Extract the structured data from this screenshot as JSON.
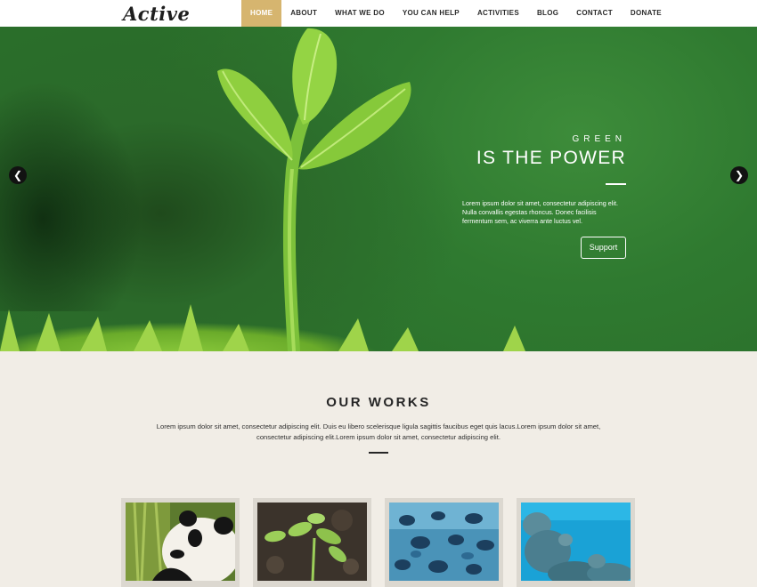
{
  "brand": {
    "logo": "Active"
  },
  "nav": {
    "items": [
      {
        "label": "HOME",
        "active": true
      },
      {
        "label": "ABOUT"
      },
      {
        "label": "WHAT WE DO"
      },
      {
        "label": "YOU CAN HELP"
      },
      {
        "label": "ACTIVITIES"
      },
      {
        "label": "BLOG"
      },
      {
        "label": "CONTACT"
      },
      {
        "label": "DONATE"
      }
    ],
    "accent": "#d6b56f"
  },
  "hero": {
    "kicker": "GREEN",
    "title": "IS THE POWER",
    "text": "Lorem ipsum dolor sit amet, consectetur adipiscing elit. Nulla convallis egestas rhoncus. Donec facilisis fermentum sem, ac viverra ante luctus vel.",
    "button": "Support",
    "prev_icon": "chevron-left-icon",
    "next_icon": "chevron-right-icon"
  },
  "works": {
    "title": "OUR WORKS",
    "text": "Lorem ipsum dolor sit amet, consectetur adipiscing elit. Duis eu libero scelerisque ligula sagittis faucibus eget quis lacus.Lorem ipsum dolor sit amet, consectetur adipiscing elit.Lorem ipsum dolor sit amet, consectetur adipiscing elit.",
    "tiles": [
      {
        "subject": "panda"
      },
      {
        "subject": "seedling"
      },
      {
        "subject": "fish"
      },
      {
        "subject": "coral"
      }
    ]
  }
}
